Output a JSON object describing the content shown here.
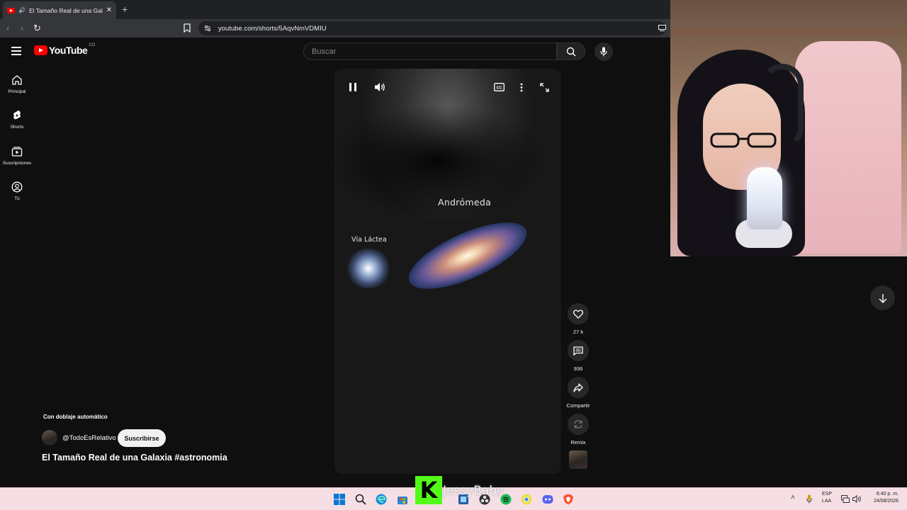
{
  "browser": {
    "tab_title": "El Tamaño Real de una Galaxia",
    "url": "youtube.com/shorts/5AqvNmVDMIU"
  },
  "header": {
    "logo_text": "YouTube",
    "country_code": "CO",
    "search_placeholder": "Buscar"
  },
  "guide": {
    "items": [
      {
        "label": "Principal",
        "icon": "home-icon"
      },
      {
        "label": "Shorts",
        "icon": "shorts-icon"
      },
      {
        "label": "Suscripciones",
        "icon": "subscriptions-icon"
      },
      {
        "label": "Tú",
        "icon": "account-icon"
      }
    ]
  },
  "video": {
    "label_andromeda": "Andrómeda",
    "label_milky_way": "Vía Láctea",
    "playing": true
  },
  "actions": {
    "likes": "27 k",
    "comments": "936",
    "share_label": "Compartir",
    "remix_label": "Remix"
  },
  "short": {
    "dub_note": "Con doblaje automático",
    "channel": "@TodoEsRelativo",
    "subscribe_label": "Suscribirse",
    "title": "El Tamaño Real de una Galaxia #astronomia"
  },
  "overlay": {
    "kick_letter": "K",
    "streamer_name": "JessyBaby"
  },
  "taskbar": {
    "lang_line1": "ESP",
    "lang_line2": "LAA",
    "time": "6:40 p. m.",
    "date": "24/08/2026"
  },
  "colors": {
    "youtube_red": "#ff0000",
    "kick_green": "#53fc18",
    "page_bg": "#0f0f0f",
    "taskbar_bg": "#f5dfe4"
  }
}
